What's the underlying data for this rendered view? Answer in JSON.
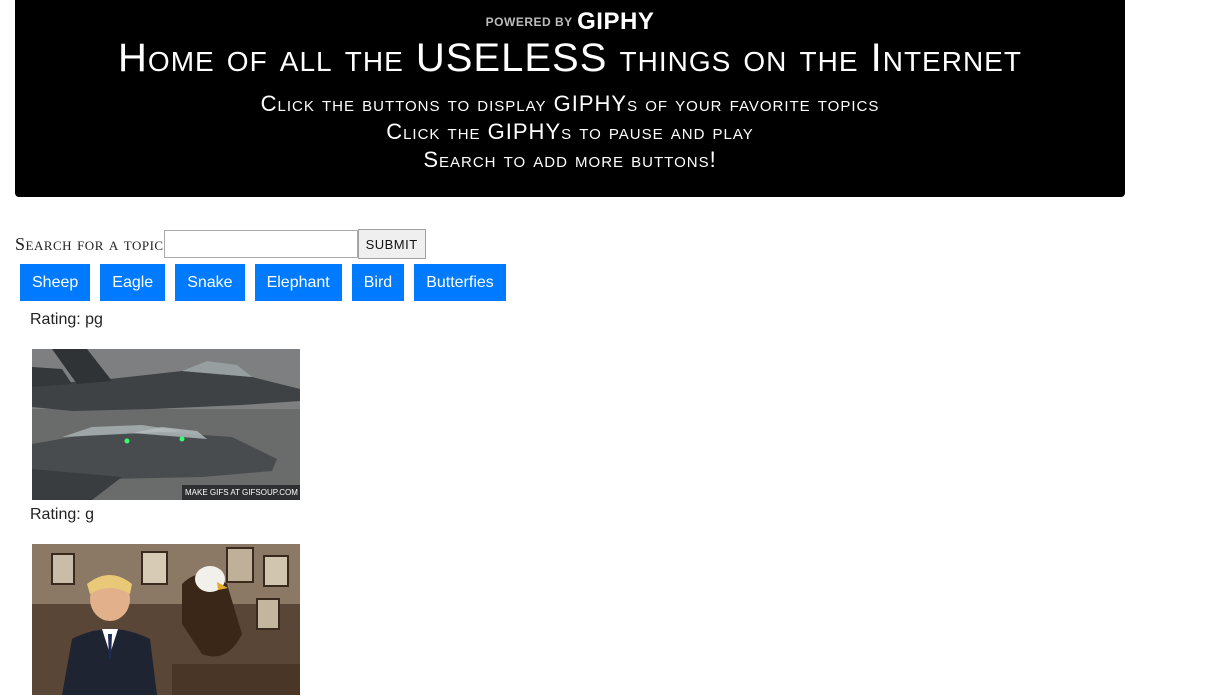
{
  "header": {
    "powered_by": "POWERED BY",
    "giphy_logo": "GIPHY",
    "title": "Home of all the USELESS things on the Internet",
    "subtitles": [
      "Click the buttons to display GIPHYs of your favorite topics",
      "Click the GIPHYs to pause and play",
      "Search to add more buttons!"
    ]
  },
  "search": {
    "label": "Search for a topic",
    "value": "",
    "placeholder": "",
    "submit_label": "SUBMIT"
  },
  "topics": [
    "Sheep",
    "Eagle",
    "Snake",
    "Elephant",
    "Bird",
    "Butterfies"
  ],
  "gifs": [
    {
      "rating": "Rating: pg",
      "watermark": "MAKE GIFS AT GIFSOUP.COM"
    },
    {
      "rating": "Rating: g"
    }
  ],
  "colors": {
    "banner_bg": "#000000",
    "button_bg": "#007bff",
    "button_text": "#ffffff"
  }
}
